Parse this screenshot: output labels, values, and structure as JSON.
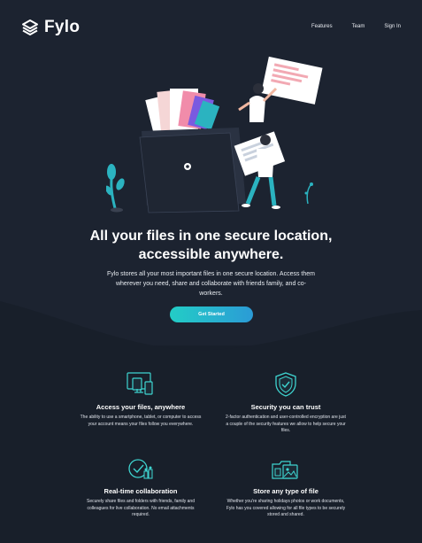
{
  "brand": {
    "name": "Fylo"
  },
  "nav": {
    "features": "Features",
    "team": "Team",
    "signin": "Sign In"
  },
  "hero": {
    "title_line1": "All your files in one secure location,",
    "title_line2": "accessible anywhere.",
    "description": "Fylo stores all your most important files in one secure location. Access them wherever you need, share and collaborate with friends family, and co-workers.",
    "cta_label": "Get Started"
  },
  "features": [
    {
      "icon": "access-anywhere-icon",
      "title": "Access your files, anywhere",
      "text": "The ability to use a smartphone, tablet, or computer to access your account means your files follow you everywhere."
    },
    {
      "icon": "security-icon",
      "title": "Security you can trust",
      "text": "2-factor authentication and user-controlled encryption are just a couple of the security features we allow to help secure your files."
    },
    {
      "icon": "collaboration-icon",
      "title": "Real-time collaboration",
      "text": "Securely share files and folders with friends, family and colleagues for live collaboration. No email attachments required."
    },
    {
      "icon": "any-file-icon",
      "title": "Store any type of file",
      "text": "Whether you're sharing holidays photos or work documents, Fylo has you covered allowing for all file types to be securely stored and shared."
    }
  ],
  "colors": {
    "background": "#181f2a",
    "hero_background": "#1c2330",
    "accent_start": "#23cdc6",
    "accent_end": "#2b9bd6",
    "icon_stroke": "#3ed4d0"
  }
}
